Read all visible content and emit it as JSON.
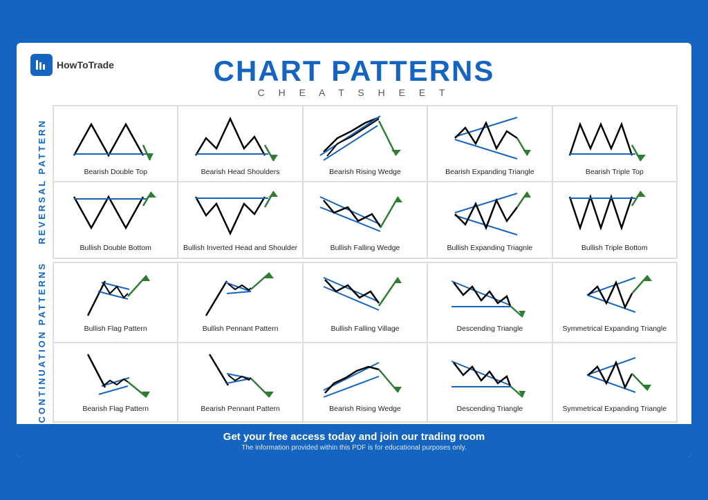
{
  "header": {
    "logo_text": "HowToTrade",
    "title": "CHART PATTERNS",
    "subtitle": "C H E A T   S H E E T"
  },
  "sections": [
    {
      "label": "REVERSAL PATTERN",
      "rows": 2,
      "patterns": [
        {
          "id": "bearish-double-top",
          "label": "Bearish Double Top"
        },
        {
          "id": "bearish-head-shoulders",
          "label": "Bearish Head Shoulders"
        },
        {
          "id": "bearish-rising-wedge",
          "label": "Bearish Rising Wedge"
        },
        {
          "id": "bearish-expanding-triangle",
          "label": "Bearish Expanding Triangle"
        },
        {
          "id": "bearish-triple-top",
          "label": "Bearish Triple Top"
        },
        {
          "id": "bullish-double-bottom",
          "label": "Bullish Double Bottom"
        },
        {
          "id": "bullish-inverted-head-shoulder",
          "label": "Bullish Inverted Head and Shoulder"
        },
        {
          "id": "bullish-falling-wedge",
          "label": "Bullish Falling Wedge"
        },
        {
          "id": "bullish-expanding-triangle",
          "label": "Bullish Expanding Triagnle"
        },
        {
          "id": "bullish-triple-bottom",
          "label": "Bullish Triple Bottom"
        }
      ]
    },
    {
      "label": "CONTINUATION PATTERNS",
      "rows": 2,
      "patterns": [
        {
          "id": "bullish-flag-pattern",
          "label": "Bullish Flag Pattern"
        },
        {
          "id": "bullish-pennant-pattern",
          "label": "Bullish Pennant Pattern"
        },
        {
          "id": "bullish-falling-village",
          "label": "Bullish Falling Village"
        },
        {
          "id": "descending-triangle-1",
          "label": "Descending Triangle"
        },
        {
          "id": "symmetrical-expanding-triangle-1",
          "label": "Symmetrical Expanding Triangle"
        },
        {
          "id": "bearish-flag-pattern",
          "label": "Bearish Flag Pattern"
        },
        {
          "id": "bearish-pennant-pattern",
          "label": "Bearish Pennant Pattern"
        },
        {
          "id": "bearish-rising-wedge-2",
          "label": "Bearish Rising Wedge"
        },
        {
          "id": "descending-triangle-2",
          "label": "Descending Triangle"
        },
        {
          "id": "symmetrical-expanding-triangle-2",
          "label": "Symmetrical Expanding Triangle"
        }
      ]
    }
  ],
  "footer": {
    "main": "Get your free access today and join our trading room",
    "sub": "The information provided within this PDF is for educational purposes only."
  }
}
